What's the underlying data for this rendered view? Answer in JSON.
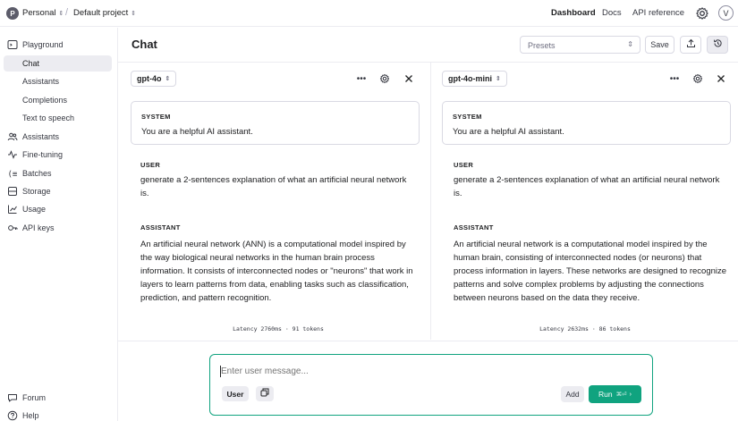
{
  "topbar": {
    "org_initial": "P",
    "org_name": "Personal",
    "separator": "/",
    "project_name": "Default project",
    "nav": [
      "Dashboard",
      "Docs",
      "API reference"
    ],
    "user_initial": "V"
  },
  "sidebar": {
    "items": [
      {
        "label": "Playground",
        "icon": "terminal-icon"
      },
      {
        "label": "Chat",
        "active": true
      },
      {
        "label": "Assistants"
      },
      {
        "label": "Completions"
      },
      {
        "label": "Text to speech"
      },
      {
        "label": "Assistants",
        "icon": "assistants-icon"
      },
      {
        "label": "Fine-tuning",
        "icon": "fine-tuning-icon"
      },
      {
        "label": "Batches",
        "icon": "batches-icon"
      },
      {
        "label": "Storage",
        "icon": "storage-icon"
      },
      {
        "label": "Usage",
        "icon": "usage-icon"
      },
      {
        "label": "API keys",
        "icon": "key-icon"
      }
    ],
    "bottom": [
      {
        "label": "Forum",
        "icon": "forum-icon"
      },
      {
        "label": "Help",
        "icon": "help-icon"
      }
    ]
  },
  "header": {
    "title": "Chat",
    "presets_placeholder": "Presets",
    "save_label": "Save"
  },
  "panels": [
    {
      "model": "gpt-4o",
      "system_label": "SYSTEM",
      "system_text": "You are a helpful AI assistant.",
      "user_label": "USER",
      "user_text": "generate a 2-sentences explanation of what an artificial neural network is.",
      "assistant_label": "ASSISTANT",
      "assistant_text": "An artificial neural network (ANN) is a computational model inspired by the way biological neural networks in the human brain process information. It consists of interconnected nodes or \"neurons\" that work in layers to learn patterns from data, enabling tasks such as classification, prediction, and pattern recognition.",
      "latency": "Latency 2760ms · 91 tokens"
    },
    {
      "model": "gpt-4o-mini",
      "system_label": "SYSTEM",
      "system_text": "You are a helpful AI assistant.",
      "user_label": "USER",
      "user_text": "generate a 2-sentences explanation of what an artificial neural network is.",
      "assistant_label": "ASSISTANT",
      "assistant_text": "An artificial neural network is a computational model inspired by the human brain, consisting of interconnected nodes (or neurons) that process information in layers. These networks are designed to recognize patterns and solve complex problems by adjusting the connections between neurons based on the data they receive.",
      "latency": "Latency 2632ms · 86 tokens"
    }
  ],
  "composer": {
    "placeholder": "Enter user message...",
    "role_label": "User",
    "add_label": "Add",
    "run_label": "Run",
    "run_shortcut": "⌘⏎"
  },
  "colors": {
    "accent": "#10a37f",
    "border": "#d9d9e3",
    "text": "#202123"
  }
}
